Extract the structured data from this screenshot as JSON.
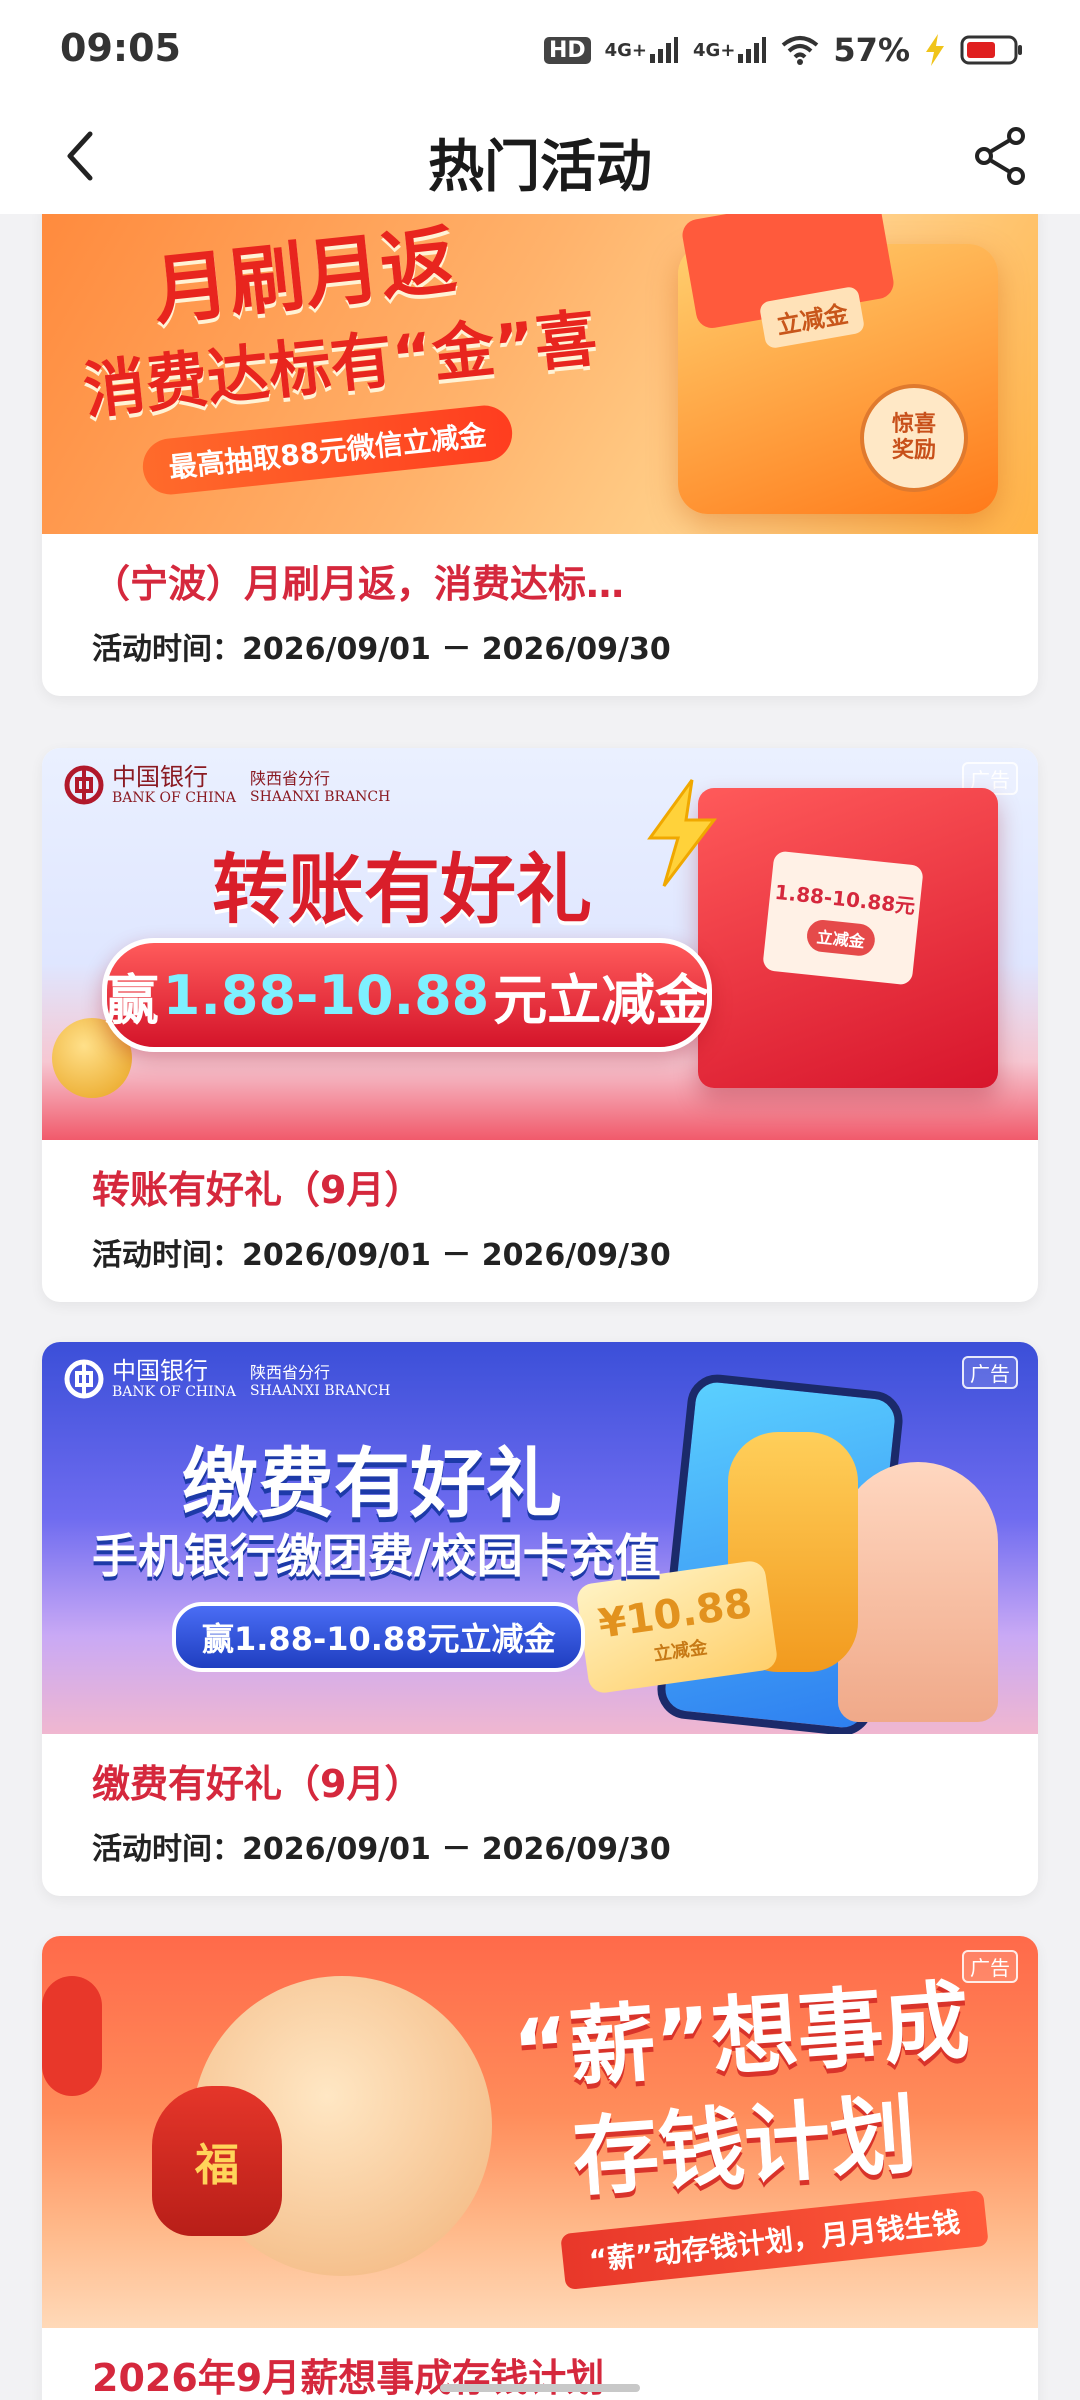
{
  "status_bar": {
    "time": "09:05",
    "battery_percent": "57%",
    "network_1": "4G+",
    "network_2": "4G+",
    "hd_label": "HD"
  },
  "header": {
    "title": "热门活动"
  },
  "activities": [
    {
      "title": "（宁波）月刷月返，消费达标…",
      "time": "活动时间：2026/09/01 － 2026/09/30",
      "banner": {
        "headline": "月刷月返",
        "subheadline": "消费达标有“金”喜",
        "pill": "最高抽取88元微信立减金",
        "coupon_label": "立减金",
        "badge": "惊喜奖励"
      }
    },
    {
      "title": "转账有好礼（9月）",
      "time": "活动时间：2026/09/01 － 2026/09/30",
      "banner": {
        "bank_name": "中国银行",
        "bank_en": "BANK OF CHINA",
        "branch": "陕西省分行",
        "branch_en": "SHAANXI BRANCH",
        "ad_tag": "广告",
        "headline": "转账有好礼",
        "prize_prefix": "赢",
        "prize_amount": "1.88-10.88",
        "prize_suffix": "元立减金",
        "card_amount": "1.88-10.88元",
        "card_label": "立减金"
      }
    },
    {
      "title": "缴费有好礼（9月）",
      "time": "活动时间：2026/09/01 － 2026/09/30",
      "banner": {
        "bank_name": "中国银行",
        "bank_en": "BANK OF CHINA",
        "branch": "陕西省分行",
        "branch_en": "SHAANXI BRANCH",
        "ad_tag": "广告",
        "headline": "缴费有好礼",
        "subheadline": "手机银行缴团费/校园卡充值",
        "pill": "赢1.88-10.88元立减金",
        "coupon_amount": "¥10.88",
        "coupon_label": "立减金"
      }
    },
    {
      "title": "2026年9月薪想事成存钱计划",
      "time": "",
      "banner": {
        "ad_tag": "广告",
        "headline_1": "“薪”想事成",
        "headline_2": "存钱计划",
        "ribbon": "“薪”动存钱计划，月月钱生钱",
        "bag_char": "福"
      }
    }
  ],
  "colors": {
    "title_red": "#d5283d",
    "page_bg": "#f2f2f4"
  }
}
